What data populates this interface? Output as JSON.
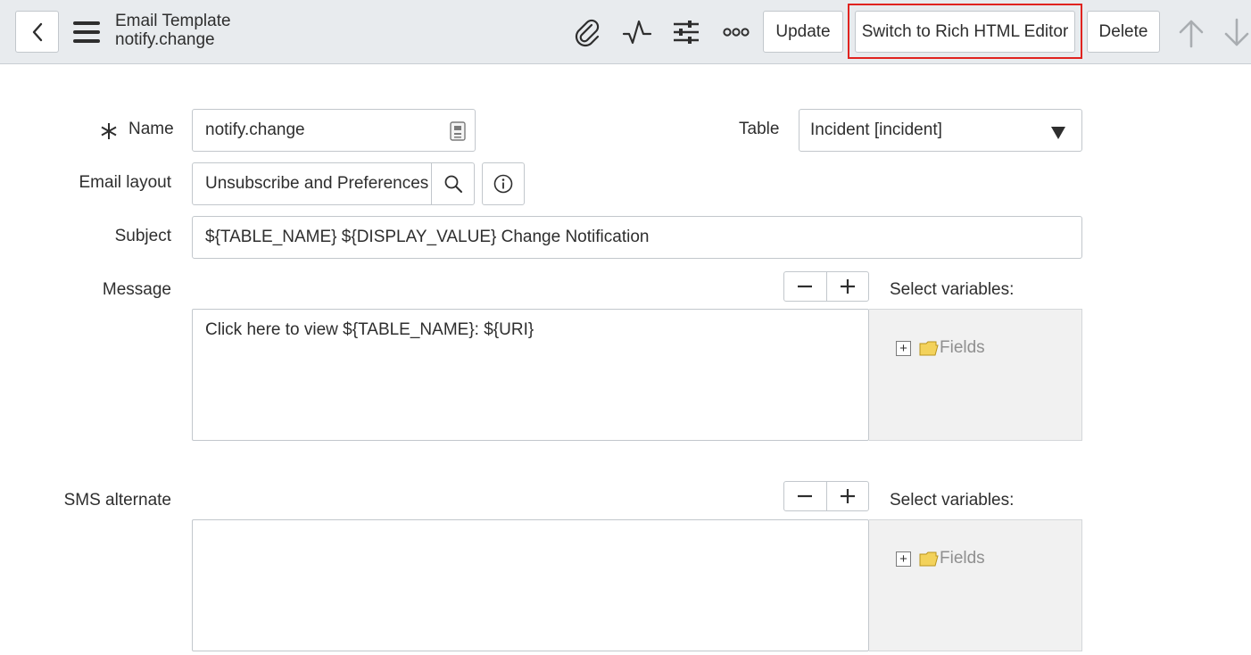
{
  "header": {
    "title": "Email Template",
    "subtitle": "notify.change",
    "update_label": "Update",
    "rich_html_label": "Switch to Rich HTML Editor",
    "delete_label": "Delete",
    "icons": [
      "back-icon",
      "menu-icon",
      "paperclip-icon",
      "activity-icon",
      "settings-sliders-icon",
      "more-icon",
      "arrow-up-icon",
      "arrow-down-icon"
    ],
    "highlight_color": "#e0231f"
  },
  "form": {
    "name": {
      "label": "Name",
      "value": "notify.change",
      "required": true
    },
    "table": {
      "label": "Table",
      "value": "Incident [incident]"
    },
    "email_layout": {
      "label": "Email layout",
      "value": "Unsubscribe and Preferences"
    },
    "subject": {
      "label": "Subject",
      "value": "${TABLE_NAME} ${DISPLAY_VALUE} Change Notification"
    },
    "message": {
      "label": "Message",
      "value": "Click here to view ${TABLE_NAME}: ${URI}",
      "select_variables_label": "Select variables:",
      "tree_node": "Fields"
    },
    "sms_alternate": {
      "label": "SMS alternate",
      "value": "",
      "select_variables_label": "Select variables:",
      "tree_node": "Fields"
    }
  }
}
